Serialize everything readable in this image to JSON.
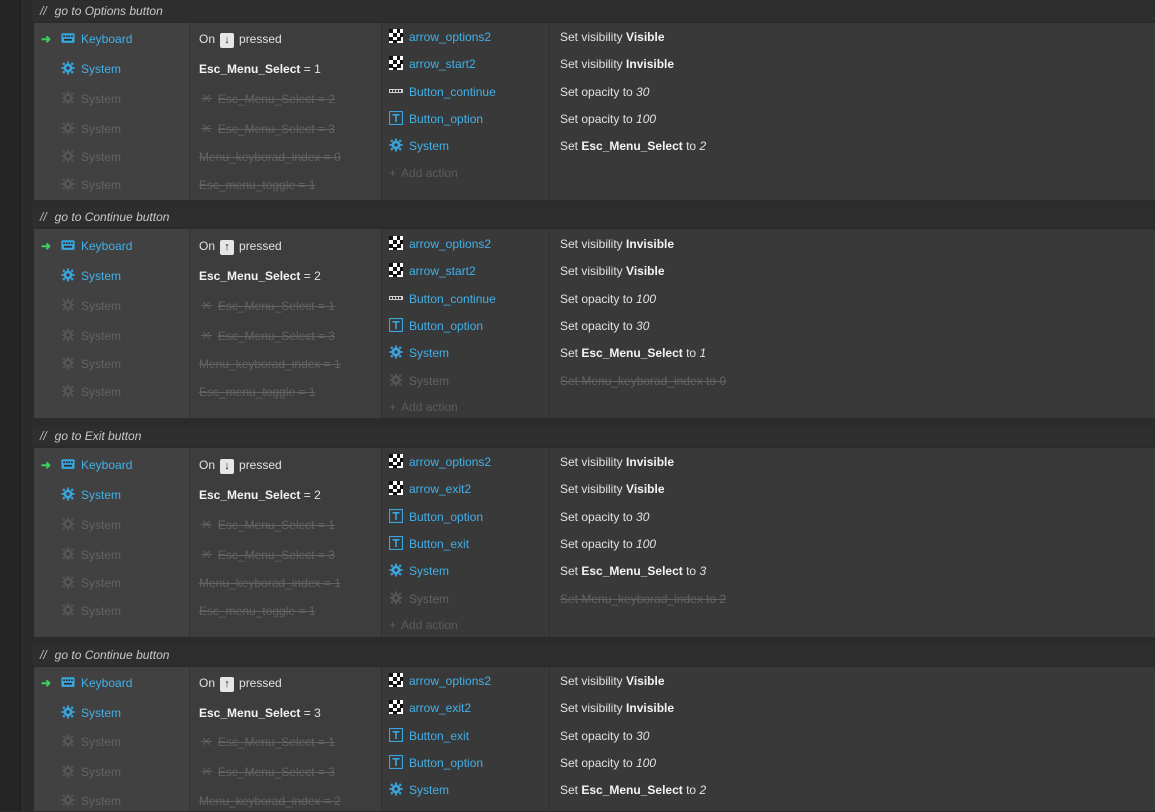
{
  "colors": {
    "background": "#2b2b2b",
    "object_blue": "#42b0e8",
    "trigger_green": "#3bd15f",
    "disabled": "#636363"
  },
  "icons": {
    "keyboard": "keyboard-icon",
    "system": "gear-icon",
    "sprite": "checker-sprite-icon",
    "text": "text-t-icon",
    "tiled": "tiled-bg-icon",
    "add": "plus-icon",
    "cross": "cross-icon",
    "trigger": "trigger-arrow-icon"
  },
  "blocks": [
    {
      "comment": "go to Options button",
      "conditions": [
        {
          "object": "Keyboard",
          "icon": "keyboard",
          "trigger": true,
          "parts": [
            "On",
            "↓",
            "pressed"
          ],
          "type": "key"
        },
        {
          "object": "System",
          "icon": "system",
          "text_bold": "Esc_Menu_Select",
          "text_rest": " = 1"
        },
        {
          "object": "System",
          "icon": "system",
          "disabled": true,
          "invert": true,
          "text": "Esc_Menu_Select = 2"
        },
        {
          "object": "System",
          "icon": "system",
          "disabled": true,
          "invert": true,
          "text": "Esc_Menu_Select = 3"
        },
        {
          "object": "System",
          "icon": "system",
          "disabled": true,
          "text": "Menu_keyborad_index = 0"
        },
        {
          "object": "System",
          "icon": "system",
          "disabled": true,
          "text": "Esc_menu_toggle = 1"
        }
      ],
      "actions": [
        {
          "object": "arrow_options2",
          "icon": "sprite",
          "prefix": "Set visibility ",
          "bold": "Visible",
          "italic": ""
        },
        {
          "object": "arrow_start2",
          "icon": "sprite",
          "prefix": "Set visibility ",
          "bold": "Invisible",
          "italic": ""
        },
        {
          "object": "Button_continue",
          "icon": "tiled",
          "prefix": "Set opacity to ",
          "bold": "",
          "italic": "30"
        },
        {
          "object": "Button_option",
          "icon": "text",
          "prefix": "Set opacity to ",
          "bold": "",
          "italic": "100"
        },
        {
          "object": "System",
          "icon": "system",
          "prefix": "Set ",
          "bold": "Esc_Menu_Select",
          "mid": " to ",
          "italic": "2"
        }
      ],
      "add_action": "Add action"
    },
    {
      "comment": "go to Continue button",
      "conditions": [
        {
          "object": "Keyboard",
          "icon": "keyboard",
          "trigger": true,
          "parts": [
            "On",
            "↑",
            "pressed"
          ],
          "type": "key"
        },
        {
          "object": "System",
          "icon": "system",
          "text_bold": "Esc_Menu_Select",
          "text_rest": " = 2"
        },
        {
          "object": "System",
          "icon": "system",
          "disabled": true,
          "invert": true,
          "text": "Esc_Menu_Select = 1"
        },
        {
          "object": "System",
          "icon": "system",
          "disabled": true,
          "invert": true,
          "text": "Esc_Menu_Select = 3"
        },
        {
          "object": "System",
          "icon": "system",
          "disabled": true,
          "text": "Menu_keyborad_index = 1"
        },
        {
          "object": "System",
          "icon": "system",
          "disabled": true,
          "text": "Esc_menu_toggle = 1"
        }
      ],
      "actions": [
        {
          "object": "arrow_options2",
          "icon": "sprite",
          "prefix": "Set visibility ",
          "bold": "Invisible",
          "italic": ""
        },
        {
          "object": "arrow_start2",
          "icon": "sprite",
          "prefix": "Set visibility ",
          "bold": "Visible",
          "italic": ""
        },
        {
          "object": "Button_continue",
          "icon": "tiled",
          "prefix": "Set opacity to ",
          "bold": "",
          "italic": "100"
        },
        {
          "object": "Button_option",
          "icon": "text",
          "prefix": "Set opacity to ",
          "bold": "",
          "italic": "30"
        },
        {
          "object": "System",
          "icon": "system",
          "prefix": "Set ",
          "bold": "Esc_Menu_Select",
          "mid": " to ",
          "italic": "1"
        },
        {
          "object": "System",
          "icon": "system",
          "disabled": true,
          "text": "Set Menu_keyborad_index to 0"
        }
      ],
      "add_action": "Add action"
    },
    {
      "comment": "go to Exit button",
      "conditions": [
        {
          "object": "Keyboard",
          "icon": "keyboard",
          "trigger": true,
          "parts": [
            "On",
            "↓",
            "pressed"
          ],
          "type": "key"
        },
        {
          "object": "System",
          "icon": "system",
          "text_bold": "Esc_Menu_Select",
          "text_rest": " = 2"
        },
        {
          "object": "System",
          "icon": "system",
          "disabled": true,
          "invert": true,
          "text": "Esc_Menu_Select = 1"
        },
        {
          "object": "System",
          "icon": "system",
          "disabled": true,
          "invert": true,
          "text": "Esc_Menu_Select = 3"
        },
        {
          "object": "System",
          "icon": "system",
          "disabled": true,
          "text": "Menu_keyborad_index = 1"
        },
        {
          "object": "System",
          "icon": "system",
          "disabled": true,
          "text": "Esc_menu_toggle = 1"
        }
      ],
      "actions": [
        {
          "object": "arrow_options2",
          "icon": "sprite",
          "prefix": "Set visibility ",
          "bold": "Invisible",
          "italic": ""
        },
        {
          "object": "arrow_exit2",
          "icon": "sprite",
          "prefix": "Set visibility ",
          "bold": "Visible",
          "italic": ""
        },
        {
          "object": "Button_option",
          "icon": "text",
          "prefix": "Set opacity to ",
          "bold": "",
          "italic": "30"
        },
        {
          "object": "Button_exit",
          "icon": "text",
          "prefix": "Set opacity to ",
          "bold": "",
          "italic": "100"
        },
        {
          "object": "System",
          "icon": "system",
          "prefix": "Set ",
          "bold": "Esc_Menu_Select",
          "mid": " to ",
          "italic": "3"
        },
        {
          "object": "System",
          "icon": "system",
          "disabled": true,
          "text": "Set Menu_keyborad_index to 2"
        }
      ],
      "add_action": "Add action"
    },
    {
      "comment": "go to Continue button",
      "conditions": [
        {
          "object": "Keyboard",
          "icon": "keyboard",
          "trigger": true,
          "parts": [
            "On",
            "↑",
            "pressed"
          ],
          "type": "key"
        },
        {
          "object": "System",
          "icon": "system",
          "text_bold": "Esc_Menu_Select",
          "text_rest": " = 3"
        },
        {
          "object": "System",
          "icon": "system",
          "disabled": true,
          "invert": true,
          "text": "Esc_Menu_Select = 1"
        },
        {
          "object": "System",
          "icon": "system",
          "disabled": true,
          "invert": true,
          "text": "Esc_Menu_Select = 3"
        },
        {
          "object": "System",
          "icon": "system",
          "disabled": true,
          "text": "Menu_keyborad_index = 2"
        }
      ],
      "actions": [
        {
          "object": "arrow_options2",
          "icon": "sprite",
          "prefix": "Set visibility ",
          "bold": "Visible",
          "italic": ""
        },
        {
          "object": "arrow_exit2",
          "icon": "sprite",
          "prefix": "Set visibility ",
          "bold": "Invisible",
          "italic": ""
        },
        {
          "object": "Button_exit",
          "icon": "text",
          "prefix": "Set opacity to ",
          "bold": "",
          "italic": "30"
        },
        {
          "object": "Button_option",
          "icon": "text",
          "prefix": "Set opacity to ",
          "bold": "",
          "italic": "100"
        },
        {
          "object": "System",
          "icon": "system",
          "prefix": "Set ",
          "bold": "Esc_Menu_Select",
          "mid": " to ",
          "italic": "2"
        }
      ],
      "add_action": ""
    }
  ]
}
